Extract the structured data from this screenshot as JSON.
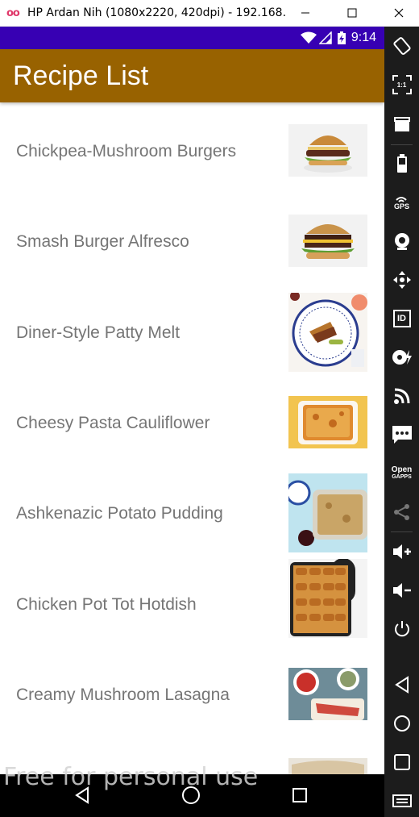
{
  "window": {
    "logo": "oo",
    "title": "HP Ardan Nih (1080x2220, 420dpi) - 192.168.2..."
  },
  "status_bar": {
    "time": "9:14"
  },
  "app_bar": {
    "title": "Recipe List"
  },
  "recipes": [
    {
      "name": "Chickpea-Mushroom Burgers"
    },
    {
      "name": "Smash Burger Alfresco"
    },
    {
      "name": "Diner-Style Patty Melt"
    },
    {
      "name": "Cheesy Pasta Cauliflower"
    },
    {
      "name": "Ashkenazic Potato Pudding"
    },
    {
      "name": "Chicken Pot Tot Hotdish"
    },
    {
      "name": "Creamy Mushroom Lasagna"
    }
  ],
  "toolbar": {
    "gps_label": "GPS",
    "id_label": "ID",
    "open_gapps_label": [
      "Open",
      "GAPPS"
    ],
    "ratio_label": "1:1"
  },
  "watermark": "Free for personal use",
  "colors": {
    "status_bar": "#3700b3",
    "app_bar": "#986200",
    "recipe_text": "#757575",
    "toolbar_bg": "#1c1c1c"
  }
}
